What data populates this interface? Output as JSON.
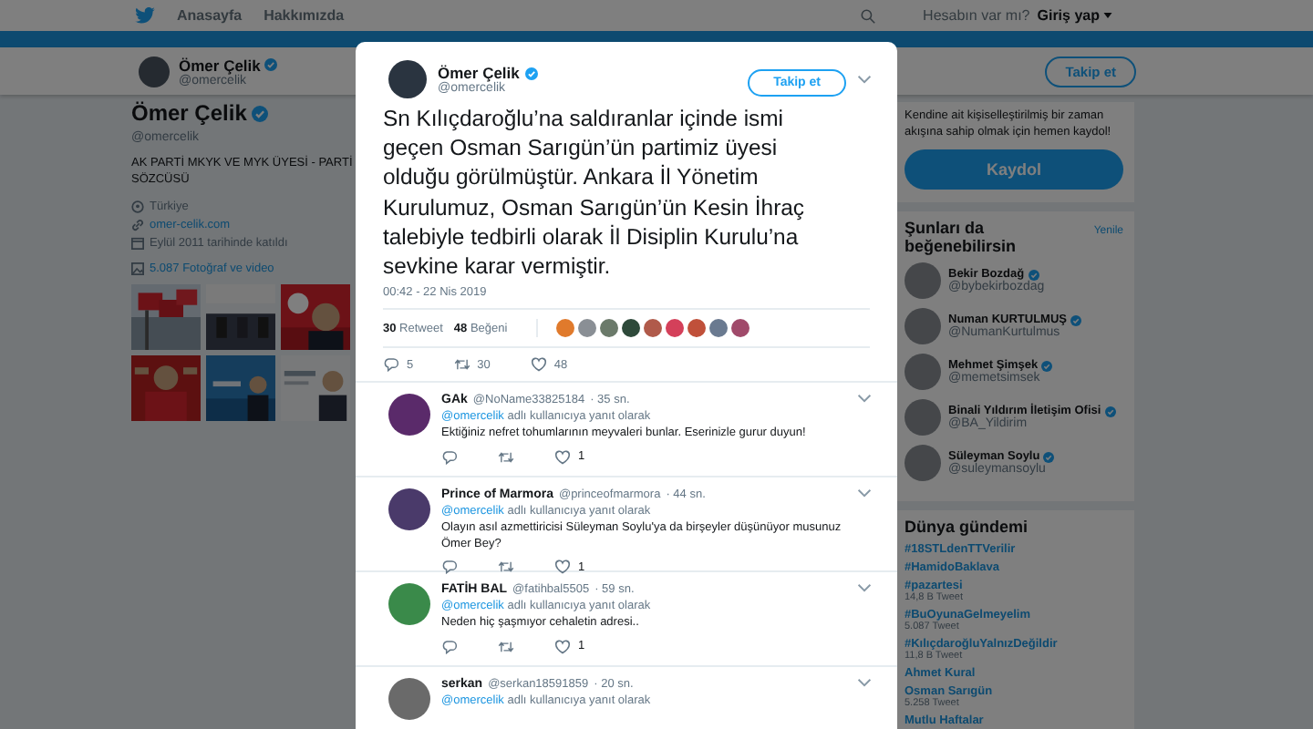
{
  "topnav": {
    "items": [
      "Anasayfa",
      "Hakkımızda"
    ],
    "account_prompt": "Hesabın var mı?",
    "login": "Giriş yap"
  },
  "profile_bar": {
    "name": "Ömer Çelik",
    "handle": "@omercelik",
    "verified": true,
    "follow_button": "Takip et"
  },
  "profile": {
    "name": "Ömer Çelik",
    "handle": "@omercelik",
    "verified": true,
    "bio": "AK PARTİ MKYK VE MYK ÜYESİ - PARTİ SÖZCÜSÜ",
    "location": "Türkiye",
    "website": "omer-celik.com",
    "joined": "Eylül 2011 tarihinde katıldı",
    "media_link": "5.087 Fotoğraf ve video"
  },
  "signup": {
    "text": "Kendine ait kişiselleştirilmiş bir zaman akışına sahip olmak için hemen kaydol!",
    "button": "Kaydol"
  },
  "suggestions": {
    "title": "Şunları da beğenebilirsin",
    "refresh": "Yenile",
    "accounts": [
      {
        "name": "Bekir Bozdağ",
        "handle": "@bybekirbozdag",
        "verified": true
      },
      {
        "name": "Numan KURTULMUŞ",
        "handle": "@NumanKurtulmus",
        "verified": true
      },
      {
        "name": "Mehmet Şimşek",
        "handle": "@memetsimsek",
        "verified": true
      },
      {
        "name": "Binali Yıldırım İletişim Ofisi",
        "handle": "@BA_Yildirim",
        "verified": true
      },
      {
        "name": "Süleyman Soylu",
        "handle": "@suleymansoylu",
        "verified": true
      }
    ]
  },
  "trends": {
    "title": "Dünya gündemi",
    "items": [
      {
        "name": "#18STLdenTTVerilir"
      },
      {
        "name": "#HamidoBaklava"
      },
      {
        "name": "#pazartesi",
        "count": "14,8 B Tweet"
      },
      {
        "name": "#BuOyunaGelmeyelim",
        "count": "5.087 Tweet"
      },
      {
        "name": "#KılıçdaroğluYalnızDeğildir",
        "count": "11,8 B Tweet"
      },
      {
        "name": "Ahmet Kural"
      },
      {
        "name": "Osman Sarıgün",
        "count": "5.258 Tweet"
      },
      {
        "name": "Mutlu Haftalar"
      }
    ]
  },
  "tweet": {
    "author": {
      "name": "Ömer Çelik",
      "handle": "@omercelik",
      "verified": true
    },
    "follow_button": "Takip et",
    "text": "Sn Kılıçdaroğlu’na saldıranlar içinde ismi geçen Osman Sarıgün’ün partimiz üyesi olduğu görülmüştür. Ankara İl Yönetim Kurulumuz, Osman Sarıgün’ün Kesin İhraç talebiyle tedbirli olarak İl Disiplin Kurulu’na sevkine karar vermiştir.",
    "time": "00:42 - 22 Nis 2019",
    "stats": {
      "retweets": "30",
      "retweets_label": "Retweet",
      "likes": "48",
      "likes_label": "Beğeni"
    },
    "likers": [
      {
        "color": "#e07a2c"
      },
      {
        "color": "#8a8f95"
      },
      {
        "color": "#6b7a6a"
      },
      {
        "color": "#2e4a3a"
      },
      {
        "color": "#b05a4a"
      },
      {
        "color": "#d4405a"
      },
      {
        "color": "#c0503a"
      },
      {
        "color": "#6a7a90"
      },
      {
        "color": "#a04a6a"
      }
    ],
    "actions": {
      "replies": "5",
      "retweets": "30",
      "likes": "48"
    }
  },
  "replies": [
    {
      "name": "GAk",
      "handle": "@NoName33825184",
      "time": "· 35 sn.",
      "reply_to": "@omercelik",
      "reply_note": "adlı kullanıcıya yanıt olarak",
      "text": "Ektiğiniz nefret tohumlarının meyvaleri bunlar. Eserinizle gurur duyun!",
      "likes": "1",
      "color": "#5a2a6a"
    },
    {
      "name": "Prince of Marmora",
      "handle": "@princeofmarmora",
      "time": "· 44 sn.",
      "reply_to": "@omercelik",
      "reply_note": "adlı kullanıcıya yanıt olarak",
      "text": "Olayın asıl azmettiricisi Süleyman Soylu'ya da birşeyler düşünüyor musunuz Ömer Bey?",
      "likes": "1",
      "color": "#4a3a6a"
    },
    {
      "name": "FATİH BAL",
      "handle": "@fatihbal5505",
      "time": "· 59 sn.",
      "reply_to": "@omercelik",
      "reply_note": "adlı kullanıcıya yanıt olarak",
      "text": "Neden hiç şaşmıyor cehaletin adresi..",
      "likes": "1",
      "color": "#3a8a4a"
    },
    {
      "name": "serkan",
      "handle": "@serkan18591859",
      "time": "· 20 sn.",
      "reply_to": "@omercelik",
      "reply_note": "adlı kullanıcıya yanıt olarak",
      "color": "#6a6a6a"
    }
  ]
}
